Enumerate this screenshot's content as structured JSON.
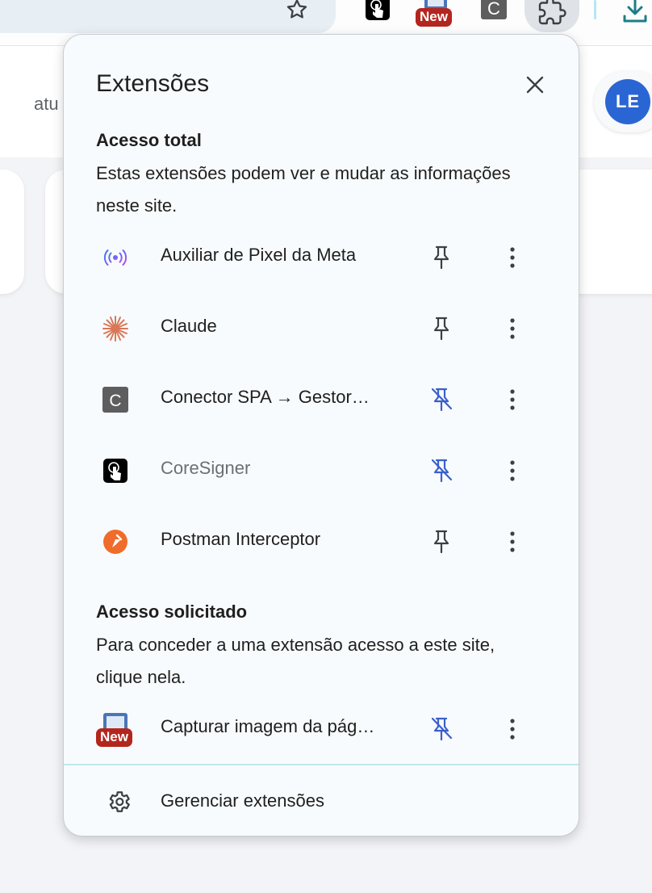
{
  "toolbar": {
    "new_badge": "New",
    "conector_letter": "C"
  },
  "page": {
    "partial_text": "atu",
    "avatar_initials": "LE"
  },
  "popup": {
    "title": "Extensões",
    "full_access": {
      "title": "Acesso total",
      "description": "Estas extensões podem ver e mudar as informações neste site.",
      "extensions": [
        {
          "name": "Auxiliar de Pixel da Meta",
          "icon": "meta-pixel-icon",
          "pinned": true
        },
        {
          "name": "Claude",
          "icon": "claude-icon",
          "pinned": true
        },
        {
          "name": "Conector SPA → Gestor…",
          "icon": "conector-icon",
          "pinned": false,
          "icon_letter": "C"
        },
        {
          "name": "CoreSigner",
          "icon": "coresigner-icon",
          "pinned": false
        },
        {
          "name": "Postman Interceptor",
          "icon": "postman-icon",
          "pinned": true
        }
      ]
    },
    "requested_access": {
      "title": "Acesso solicitado",
      "description": "Para conceder a uma extensão acesso a este site, clique nela.",
      "extensions": [
        {
          "name": "Capturar imagem da pág…",
          "icon": "capture-icon",
          "pinned": false,
          "badge": "New"
        }
      ]
    },
    "manage_label": "Gerenciar extensões"
  },
  "colors": {
    "pin_active": "#3a5fcd",
    "pin_inactive": "#3c4043",
    "badge": "#b3261e",
    "avatar": "#2a66d3",
    "postman": "#ef6c2b",
    "claude": "#d97757"
  }
}
